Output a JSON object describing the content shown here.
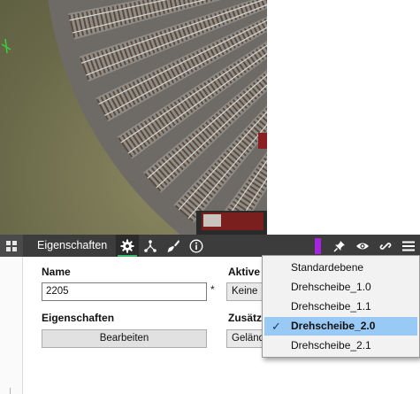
{
  "toolbar": {
    "title": "Eigenschaften",
    "icons": [
      "grid-icon",
      "gear-icon",
      "object-tree-icon",
      "brush-icon",
      "info-icon",
      "pin-icon",
      "eye-icon",
      "link-icon",
      "menu-icon"
    ],
    "accent_color": "#3bb56b",
    "marker_color": "#a624e0"
  },
  "panel": {
    "name_label": "Name",
    "name_value": "2205",
    "required_mark": "*",
    "aktive_label": "Aktive",
    "aktive_value": "Keine",
    "eigenschaften_label": "Eigenschaften",
    "bearbeiten_label": "Bearbeiten",
    "zusatz_label": "Zusätz",
    "zusatz_value": "Geländ"
  },
  "dropdown": {
    "items": [
      {
        "label": "Standardebene",
        "selected": false
      },
      {
        "label": "Drehscheibe_1.0",
        "selected": false
      },
      {
        "label": "Drehscheibe_1.1",
        "selected": false
      },
      {
        "label": "Drehscheibe_2.0",
        "selected": true
      },
      {
        "label": "Drehscheibe_2.1",
        "selected": false
      }
    ],
    "check_mark": "✓",
    "selected_color": "#99c9f5"
  }
}
